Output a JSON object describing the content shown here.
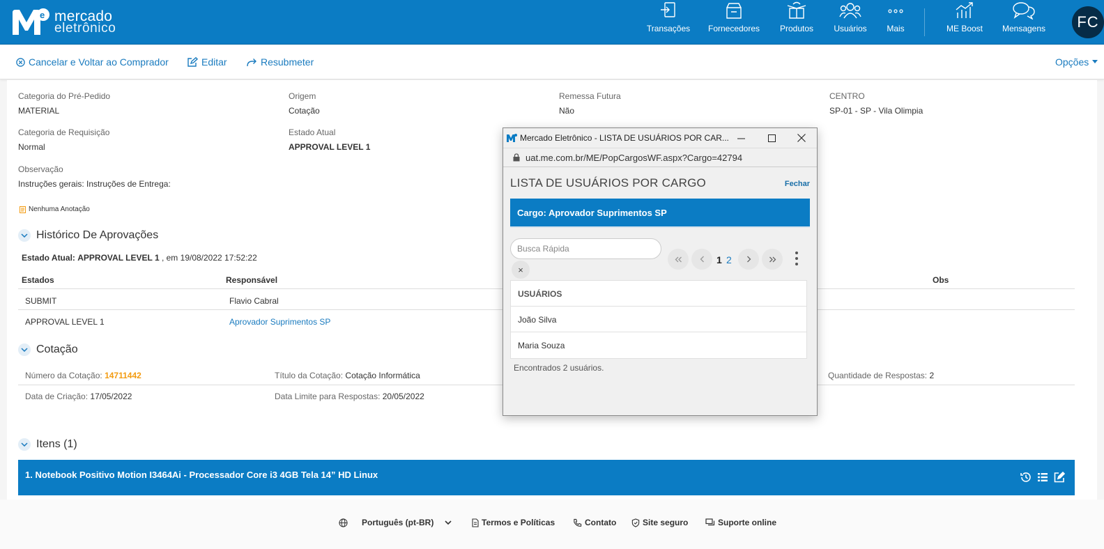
{
  "header": {
    "logo_line1": "mercado",
    "logo_line2": "eletrônico",
    "nav": [
      {
        "label": "Transações",
        "icon": "transactions-icon"
      },
      {
        "label": "Fornecedores",
        "icon": "suppliers-icon"
      },
      {
        "label": "Produtos",
        "icon": "products-icon"
      },
      {
        "label": "Usuários",
        "icon": "users-icon"
      },
      {
        "label": "Mais",
        "icon": "more-icon"
      },
      {
        "label": "ME Boost",
        "icon": "chart-icon"
      },
      {
        "label": "Mensagens",
        "icon": "messages-icon"
      }
    ],
    "avatar_initials": "FC",
    "brand_color": "#0b7cc4"
  },
  "actions": {
    "cancel": "Cancelar e Voltar ao Comprador",
    "edit": "Editar",
    "resubmit": "Resubmeter",
    "options": "Opções"
  },
  "details": {
    "categoria_pre_label": "Categoria do Pré-Pedido",
    "categoria_pre_value": "MATERIAL",
    "origem_label": "Origem",
    "origem_value": "Cotação",
    "remessa_label": "Remessa Futura",
    "remessa_value": "Não",
    "centro_label": "CENTRO",
    "centro_value": "SP-01 - SP - Vila Olimpia",
    "categoria_req_label": "Categoria de Requisição",
    "categoria_req_value": "Normal",
    "estado_label": "Estado Atual",
    "estado_value": "APPROVAL LEVEL 1",
    "obs_label": "Observação",
    "obs_value": "Instruções gerais: Instruções de Entrega:",
    "annotation": "Nenhuma Anotação"
  },
  "history": {
    "title": "Histórico De Aprovações",
    "status_prefix": "Estado Atual:",
    "status_value": "APPROVAL LEVEL 1",
    "status_suffix": ", em 19/08/2022 17:52:22",
    "col_estados": "Estados",
    "col_responsavel": "Responsável",
    "col_obs": "Obs",
    "rows": [
      {
        "estado": "SUBMIT",
        "responsavel": "Flavio Cabral"
      },
      {
        "estado": "APPROVAL LEVEL 1",
        "responsavel": "Aprovador Suprimentos SP"
      }
    ]
  },
  "cotacao": {
    "title": "Cotação",
    "numero_label": "Número da Cotação:",
    "numero_value": "14711442",
    "titulo_label": "Título da Cotação:",
    "titulo_value": "Cotação Informática",
    "qtd_label": "Quantidade de Respostas:",
    "qtd_value": "2",
    "criacao_label": "Data de Criação:",
    "criacao_value": "17/05/2022",
    "limite_label": "Data Limite para Respostas:",
    "limite_value": "20/05/2022"
  },
  "itens": {
    "title": "Itens (1)",
    "item1": "1. Notebook Positivo Motion I3464Ai - Processador Core i3 4GB Tela 14” HD Linux"
  },
  "footer": {
    "language": "Português (pt-BR)",
    "terms": "Termos e Políticas",
    "contact": "Contato",
    "secure": "Site seguro",
    "support": "Suporte online"
  },
  "popup": {
    "window_title": "Mercado Eletrônico - LISTA DE USUÁRIOS POR CAR...",
    "url": "uat.me.com.br/ME/PopCargosWF.aspx?Cargo=42794",
    "heading": "LISTA DE USUÁRIOS POR CARGO",
    "close": "Fechar",
    "cargo": "Cargo: Aprovador Suprimentos SP",
    "search_placeholder": "Busca Rápida",
    "clear": "×",
    "page1": "1",
    "page2": "2",
    "list_header": "USUÁRIOS",
    "users": [
      "João Silva",
      "Maria Souza"
    ],
    "found": "Encontrados 2 usuários."
  }
}
